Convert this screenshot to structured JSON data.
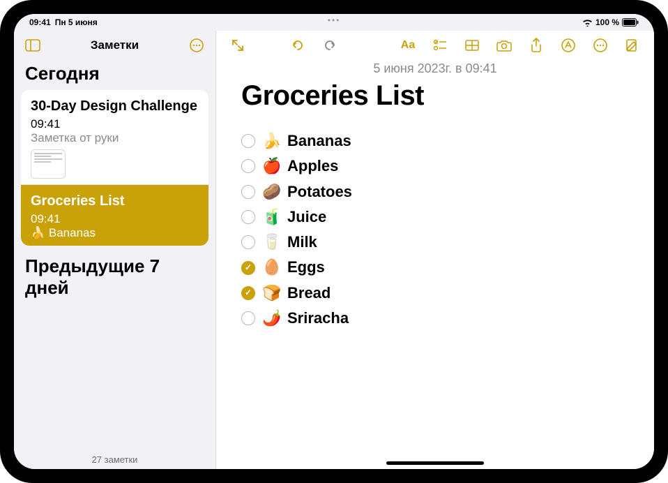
{
  "status": {
    "time": "09:41",
    "date": "Пн 5 июня",
    "battery": "100 %"
  },
  "colors": {
    "accent": "#c9a109"
  },
  "sidebar": {
    "title": "Заметки",
    "sections": {
      "today": "Сегодня",
      "prev7": "Предыдущие 7 дней"
    },
    "notes": [
      {
        "title": "30-Day Design Challenge",
        "time": "09:41",
        "preview": "Заметка от руки",
        "selected": false,
        "has_thumb": true
      },
      {
        "title": "Groceries List",
        "time": "09:41",
        "preview": "🍌 Bananas",
        "selected": true,
        "has_thumb": false
      }
    ],
    "footer": "27 заметки"
  },
  "note": {
    "date": "5 июня 2023г. в 09:41",
    "title": "Groceries List",
    "items": [
      {
        "emoji": "🍌",
        "label": "Bananas",
        "checked": false
      },
      {
        "emoji": "🍎",
        "label": "Apples",
        "checked": false
      },
      {
        "emoji": "🥔",
        "label": "Potatoes",
        "checked": false
      },
      {
        "emoji": "🧃",
        "label": "Juice",
        "checked": false
      },
      {
        "emoji": "🥛",
        "label": "Milk",
        "checked": false
      },
      {
        "emoji": "🥚",
        "label": "Eggs",
        "checked": true
      },
      {
        "emoji": "🍞",
        "label": "Bread",
        "checked": true
      },
      {
        "emoji": "🌶️",
        "label": "Sriracha",
        "checked": false
      }
    ]
  }
}
